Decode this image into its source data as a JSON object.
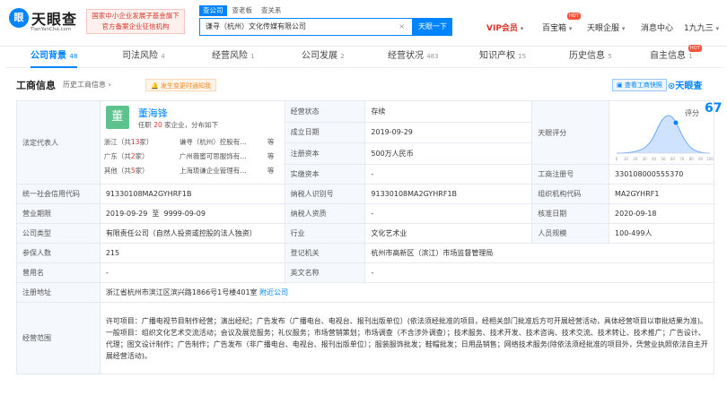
{
  "header": {
    "logo_title": "天眼查",
    "logo_mark": "眼",
    "logo_sub": "TianYanCha.com",
    "gov_badge_line1": "国家中小企业发展子基金旗下",
    "gov_badge_line2": "官方备案企业征信机构",
    "search_tabs": [
      "查公司",
      "查老板",
      "查关系"
    ],
    "search_value": "谦寻（杭州）文化传媒有限公司",
    "search_clear": "×",
    "search_button": "天眼一下",
    "nav": {
      "vip": "VIP会员",
      "shop": "百宝箱",
      "hot": "HOT",
      "corp": "天眼企服",
      "msg": "消息中心",
      "user": "1九九三"
    }
  },
  "tabs": [
    {
      "label": "公司背景",
      "count": "48"
    },
    {
      "label": "司法风险",
      "count": "4"
    },
    {
      "label": "经营风险",
      "count": "1"
    },
    {
      "label": "公司发展",
      "count": "2"
    },
    {
      "label": "经营状况",
      "count": "483"
    },
    {
      "label": "知识产权",
      "count": "15"
    },
    {
      "label": "历史信息",
      "count": "5"
    },
    {
      "label": "自主信息",
      "count": "1"
    }
  ],
  "section": {
    "title": "工商信息",
    "history": "历史工商信息 ›",
    "reminder": "🔔 发生变更时通知我",
    "snapshot": "查看工商快照",
    "brand": "⊙天眼查"
  },
  "legal": {
    "label": "法定代表人",
    "avatar": "董",
    "name": "董海锋",
    "sub_pre": "任职",
    "sub_num": "20",
    "sub_post": "家企业，分布如下",
    "rows": [
      {
        "region": "浙江",
        "mid": "共",
        "num": "13",
        "end": "家",
        "company": "谦寻（杭州）控股有...",
        "more": "等"
      },
      {
        "region": "广东",
        "mid": "共",
        "num": "2",
        "end": "家",
        "company": "广州薇蜜可思服饰有...",
        "more": "等"
      },
      {
        "region": "其他",
        "mid": "共",
        "num": "5",
        "end": "家",
        "company": "上海琐谦企业管理有...",
        "more": "等"
      }
    ]
  },
  "rows_top": [
    {
      "label": "经营状态",
      "value": "存续"
    },
    {
      "label": "成立日期",
      "value": "2019-09-29"
    },
    {
      "label": "注册资本",
      "value": "500万人民币"
    },
    {
      "label": "实缴资本",
      "value": "-"
    }
  ],
  "score": {
    "label": "天眼评分",
    "title": "评分",
    "value": "67",
    "axis": [
      "0",
      "10",
      "20",
      "30",
      "40",
      "50",
      "60",
      "70",
      "80",
      "90",
      "100"
    ]
  },
  "reg_no": {
    "label": "工商注册号",
    "value": "330108000555370"
  },
  "grid": [
    [
      "统一社会信用代码",
      "91330108MA2GYHRF1B",
      "纳税人识别号",
      "91330108MA2GYHRF1B",
      "组织机构代码",
      "MA2GYHRF1"
    ],
    [
      "营业期限",
      "2019-09-29  至  9999-09-09",
      "纳税人资质",
      "-",
      "核准日期",
      "2020-09-18"
    ],
    [
      "公司类型",
      "有限责任公司（自然人投资或控股的法人独资）",
      "行业",
      "文化艺术业",
      "人员规模",
      "100-499人"
    ],
    [
      "参保人数",
      "215",
      "登记机关",
      "杭州市高新区（滨江）市场监督管理局",
      "",
      ""
    ],
    [
      "曾用名",
      "-",
      "英文名称",
      "-",
      "",
      ""
    ]
  ],
  "address": {
    "label": "注册地址",
    "value": "浙江省杭州市滨江区滨兴路1866号1号楼401室",
    "link": "附近公司"
  },
  "scope": {
    "label": "经营范围",
    "value": "许可项目：广播电视节目制作经营；演出经纪；广告发布（广播电台、电视台、报刊出版单位）(依法须经批准的项目，经相关部门批准后方可开展经营活动，具体经营项目以审批结果为准)。一般项目：组织文化艺术交流活动；会议及展览服务；礼仪服务；市场营销策划；市场调查（不含涉外调查）；技术服务、技术开发、技术咨询、技术交流、技术转让、技术推广；广告设计、代理；图文设计制作；广告制作；广告发布（非广播电台、电视台、报刊出版单位）；服装服饰批发；鞋帽批发；日用品销售；网络技术服务(除依法须经批准的项目外，凭营业执照依法自主开展经营活动)。"
  },
  "colors": {
    "accent": "#0084ff",
    "red": "#d4382c",
    "label_bg": "#f5f8fc"
  }
}
